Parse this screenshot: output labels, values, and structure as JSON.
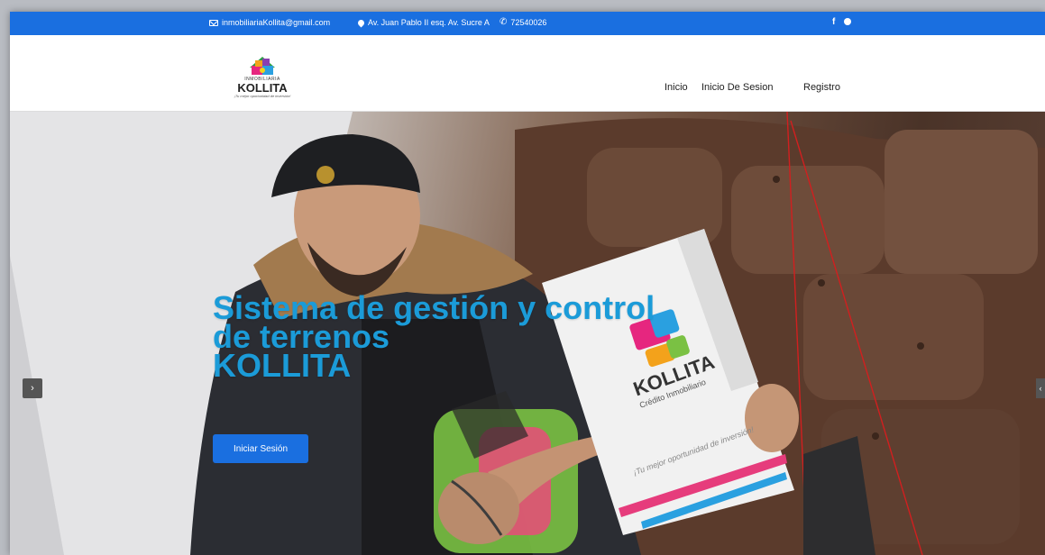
{
  "topbar": {
    "email": "inmobiliariaKollita@gmail.com",
    "address": "Av. Juan Pablo II esq. Av. Sucre A",
    "phone": "72540026",
    "social_facebook": "f",
    "icons": [
      "envelope-icon",
      "map-pin-icon",
      "phone-icon",
      "facebook-icon",
      "pinterest-icon"
    ]
  },
  "logo": {
    "line1": "INMOBILIARIA",
    "brand": "KOLLITA",
    "slogan": "¡Tu mejor oportunidad de inversión!"
  },
  "nav": {
    "items": [
      "Inicio",
      "Inicio De Sesion",
      "Registro"
    ]
  },
  "hero": {
    "title_line1": "Sistema de gestión y control",
    "title_line2": "de terrenos",
    "title_line3": "KOLLITA",
    "button_label": "Iniciar Sesión",
    "prev_label": "›",
    "next_label": "‹",
    "folder_brand": "KOLLITA",
    "folder_sub": "Crédito Inmobiliario",
    "folder_slogan": "¡Tu mejor oportunidad de inversión!"
  },
  "colors": {
    "topbar": "#1a6fe0",
    "title": "#1b9bd8",
    "button": "#1a6fe0"
  }
}
